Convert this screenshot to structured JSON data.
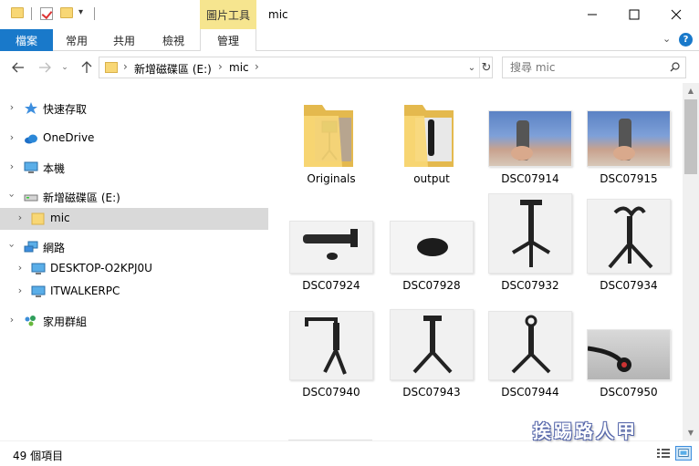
{
  "window": {
    "title": "mic",
    "context_tab": "圖片工具"
  },
  "ribbon": {
    "tabs": [
      "檔案",
      "常用",
      "共用",
      "檢視",
      "管理"
    ],
    "accent": "#1979ca",
    "context_color": "#f6e58f"
  },
  "address": {
    "crumbs": [
      "新增磁碟區 (E:)",
      "mic"
    ]
  },
  "search": {
    "placeholder": "搜尋 mic"
  },
  "sidebar": {
    "items": [
      {
        "label": "快速存取",
        "icon": "star-icon"
      },
      {
        "label": "OneDrive",
        "icon": "cloud-icon"
      },
      {
        "label": "本機",
        "icon": "computer-icon"
      },
      {
        "label": "新增磁碟區 (E:)",
        "icon": "drive-icon"
      },
      {
        "label": "mic",
        "icon": "folder-icon"
      },
      {
        "label": "網路",
        "icon": "network-icon"
      },
      {
        "label": "DESKTOP-O2KPJ0U",
        "icon": "pc-icon"
      },
      {
        "label": "ITWALKERPC",
        "icon": "pc-icon"
      },
      {
        "label": "家用群組",
        "icon": "homegroup-icon"
      }
    ]
  },
  "files": [
    {
      "name": "Originals",
      "type": "folder"
    },
    {
      "name": "output",
      "type": "folder"
    },
    {
      "name": "DSC07914",
      "type": "image"
    },
    {
      "name": "DSC07915",
      "type": "image"
    },
    {
      "name": "DSC07924",
      "type": "image"
    },
    {
      "name": "DSC07928",
      "type": "image"
    },
    {
      "name": "DSC07932",
      "type": "image"
    },
    {
      "name": "DSC07934",
      "type": "image"
    },
    {
      "name": "DSC07940",
      "type": "image"
    },
    {
      "name": "DSC07943",
      "type": "image"
    },
    {
      "name": "DSC07944",
      "type": "image"
    },
    {
      "name": "DSC07950",
      "type": "image"
    }
  ],
  "status": {
    "count": "49 個項目"
  },
  "watermark": "挨踢路人甲"
}
